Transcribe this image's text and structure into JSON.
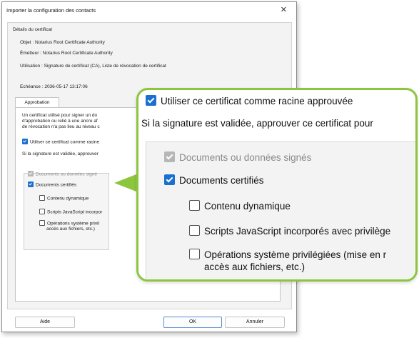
{
  "dialog": {
    "title": "Importer la configuration des contacts",
    "close_glyph": "✕",
    "section_label": "Détails du certificat",
    "subject": "Objet :  Notarius Root Certificate Authority",
    "issuer": "Émetteur :  Notarius Root Certificate Authority",
    "usage": "Utilisation :  Signature de certificat (CA), Liste de révocation de certificat",
    "expiry": "Echéance :  2036-05-17 13:17:06",
    "tab_label": "Approbation",
    "desc_lines": [
      "Un certificat utilisé pour signer un do",
      "d'approbation ou relié à une ancre af",
      "de révocation n'a pas lieu au niveau c"
    ],
    "trust_root_label": "Utiliser ce certificat comme racine",
    "if_valid_label": "Si la signature est validée, approuver",
    "opts": {
      "signed_docs": "Documents ou données signé",
      "certified_docs": "Documents certifiés",
      "dynamic_content": "Contenu dynamique",
      "js_scripts": "Scripts JavaScript incorpor",
      "os_ops_1": "Opérations système privil",
      "os_ops_2": "accès aux fichiers, etc.)"
    },
    "buttons": {
      "help": "Aide",
      "ok": "OK",
      "cancel": "Annuler"
    }
  },
  "zoom": {
    "trust_root": "Utiliser ce certificat comme racine approuvée",
    "if_valid": "Si la signature est validée, approuver ce certificat pour",
    "signed_docs": "Documents ou données signés",
    "certified_docs": "Documents certifiés",
    "dynamic_content": "Contenu dynamique",
    "js_scripts": "Scripts JavaScript incorporés avec privilège",
    "os_ops_1": "Opérations système privilégiées (mise en r",
    "os_ops_2": "accès aux fichiers, etc.)"
  },
  "colors": {
    "accent": "#1a6fd1",
    "callout": "#8cc63f"
  },
  "icons": {
    "close": "close-icon",
    "check": "checkbox-check-icon"
  }
}
